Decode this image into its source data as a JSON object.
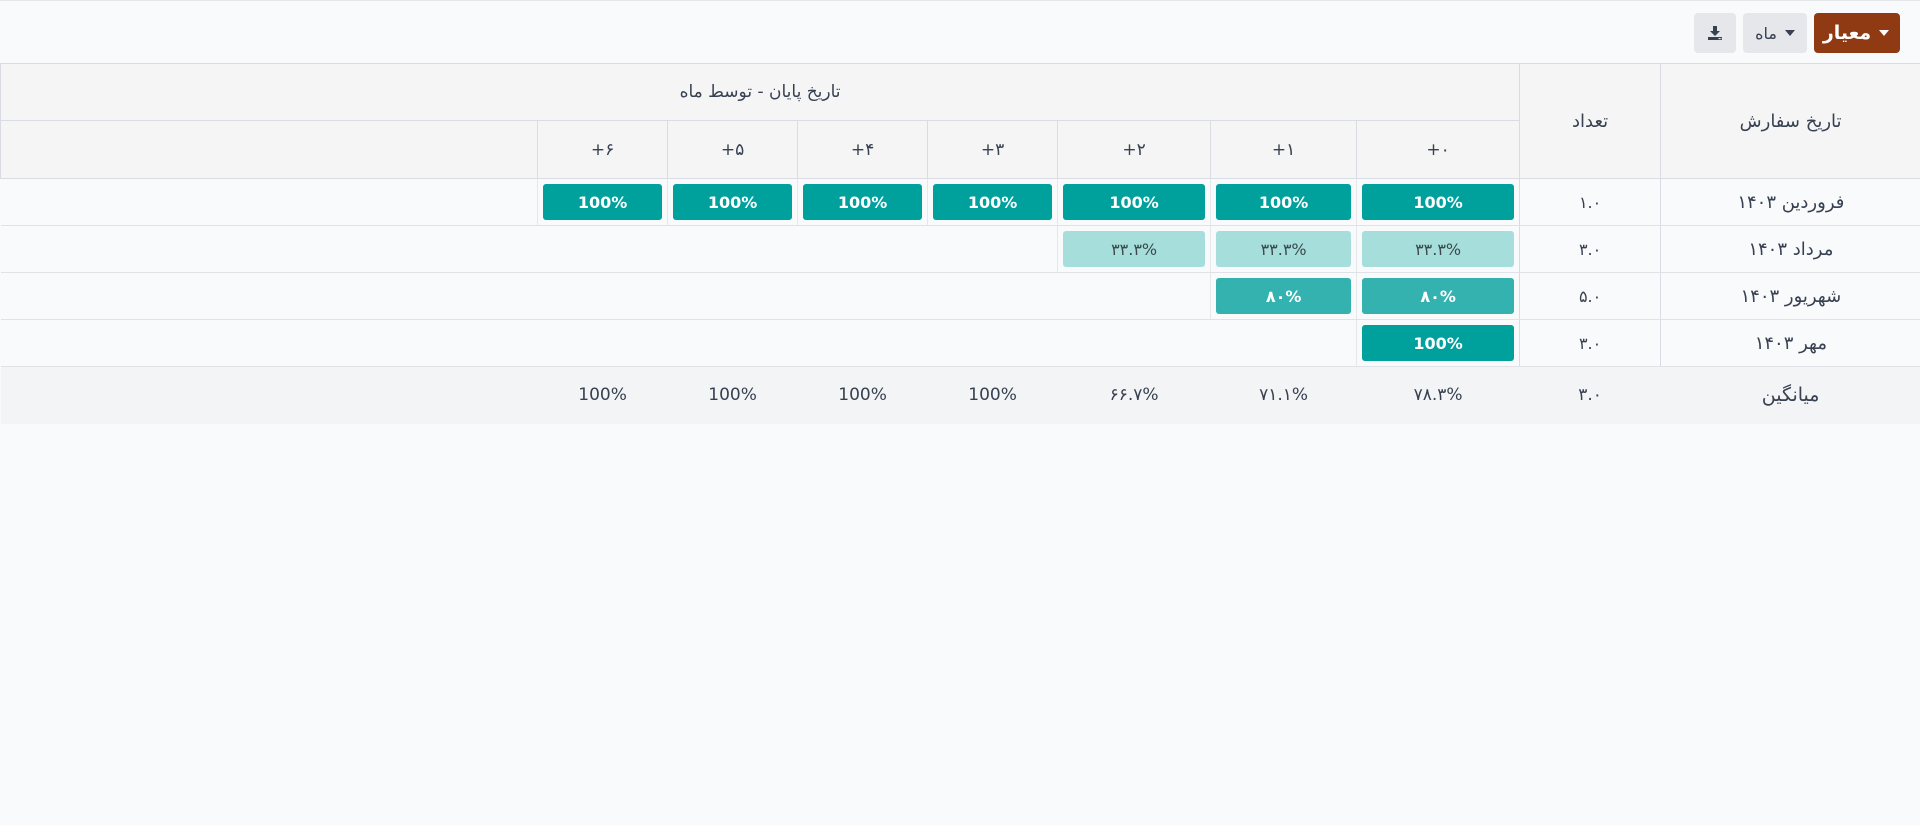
{
  "toolbar": {
    "measure_label": "معیار",
    "interval_label": "ماه",
    "download_icon": "download-icon"
  },
  "table": {
    "row_header": "تاریخ سفارش",
    "count_header": "تعداد",
    "group_header": "تاریخ پایان - توسط ماه",
    "columns": [
      "۰+",
      "۱+",
      "۲+",
      "۳+",
      "۴+",
      "۵+",
      "۶+"
    ],
    "rows": [
      {
        "label": "فروردین ۱۴۰۳",
        "count": "۱.۰",
        "cells": [
          "100%",
          "100%",
          "100%",
          "100%",
          "100%",
          "100%",
          "100%"
        ]
      },
      {
        "label": "مرداد ۱۴۰۳",
        "count": "۳.۰",
        "cells": [
          "۳۳.۳%",
          "۳۳.۳%",
          "۳۳.۳%"
        ]
      },
      {
        "label": "شهریور ۱۴۰۳",
        "count": "۵.۰",
        "cells": [
          "۸۰%",
          "۸۰%"
        ]
      },
      {
        "label": "مهر ۱۴۰۳",
        "count": "۳.۰",
        "cells": [
          "100%"
        ]
      }
    ],
    "footer": {
      "label": "میانگین",
      "count": "۳.۰",
      "values": [
        "۷۸.۳%",
        "۷۱.۱%",
        "۶۶.۷%",
        "100%",
        "100%",
        "100%",
        "100%"
      ]
    }
  },
  "colors": {
    "primary_button": "#8f3a12",
    "cell_full": "#00a09d",
    "cell_mid": "#33b2b0",
    "cell_low": "#a6dedc"
  }
}
